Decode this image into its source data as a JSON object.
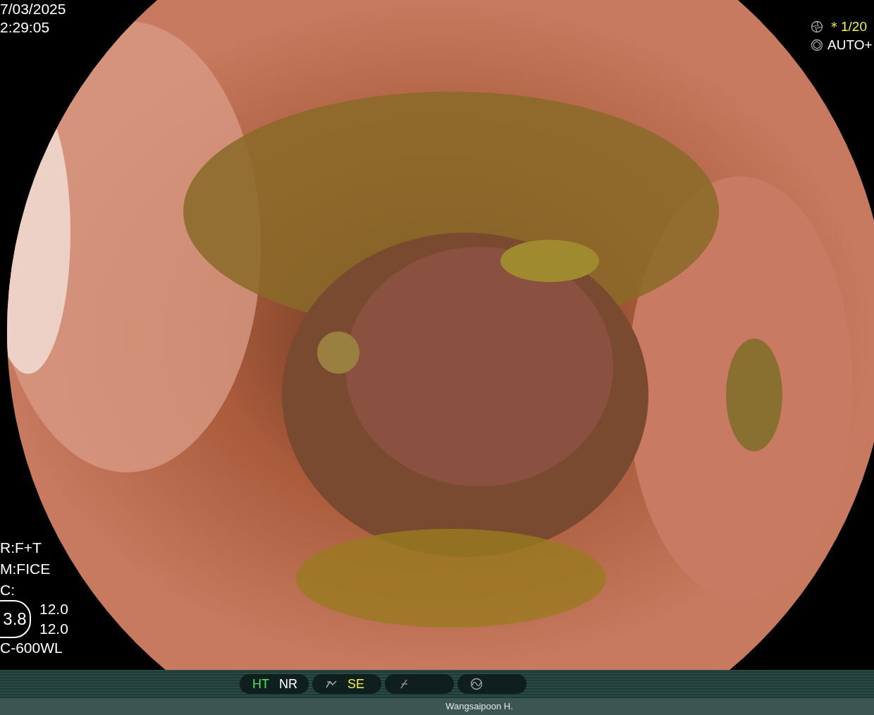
{
  "top_left": [
    {
      "text": "7/03/2025",
      "color": "#ffffff"
    },
    {
      "text": "2:29:05",
      "color": "#ffffff"
    }
  ],
  "top_right": [
    {
      "text": "＊1/20",
      "color": "#f5f04a"
    },
    {
      "text": "AUTO+",
      "color": "#ffffff"
    }
  ],
  "left_info": [
    {
      "kind": "line",
      "text": "R:F+T"
    },
    {
      "kind": "line",
      "text": "M:FICE"
    },
    {
      "kind": "line",
      "text": "C:"
    },
    {
      "kind": "gauge",
      "text": "3.8",
      "readings": [
        "12.0",
        "12.0"
      ]
    },
    {
      "kind": "line",
      "text": "C-600WL"
    }
  ],
  "status_pills": [
    {
      "kind": "labels",
      "items": [
        {
          "text": "HT",
          "color": "#5ee05e"
        },
        {
          "text": "NR",
          "color": "#ffffff"
        }
      ]
    },
    {
      "kind": "labels",
      "items": [
        {
          "text": "SE",
          "color": "#f0f050"
        }
      ]
    },
    {
      "kind": "icon"
    },
    {
      "kind": "icon"
    }
  ],
  "operator": "Wangsaipoon H."
}
